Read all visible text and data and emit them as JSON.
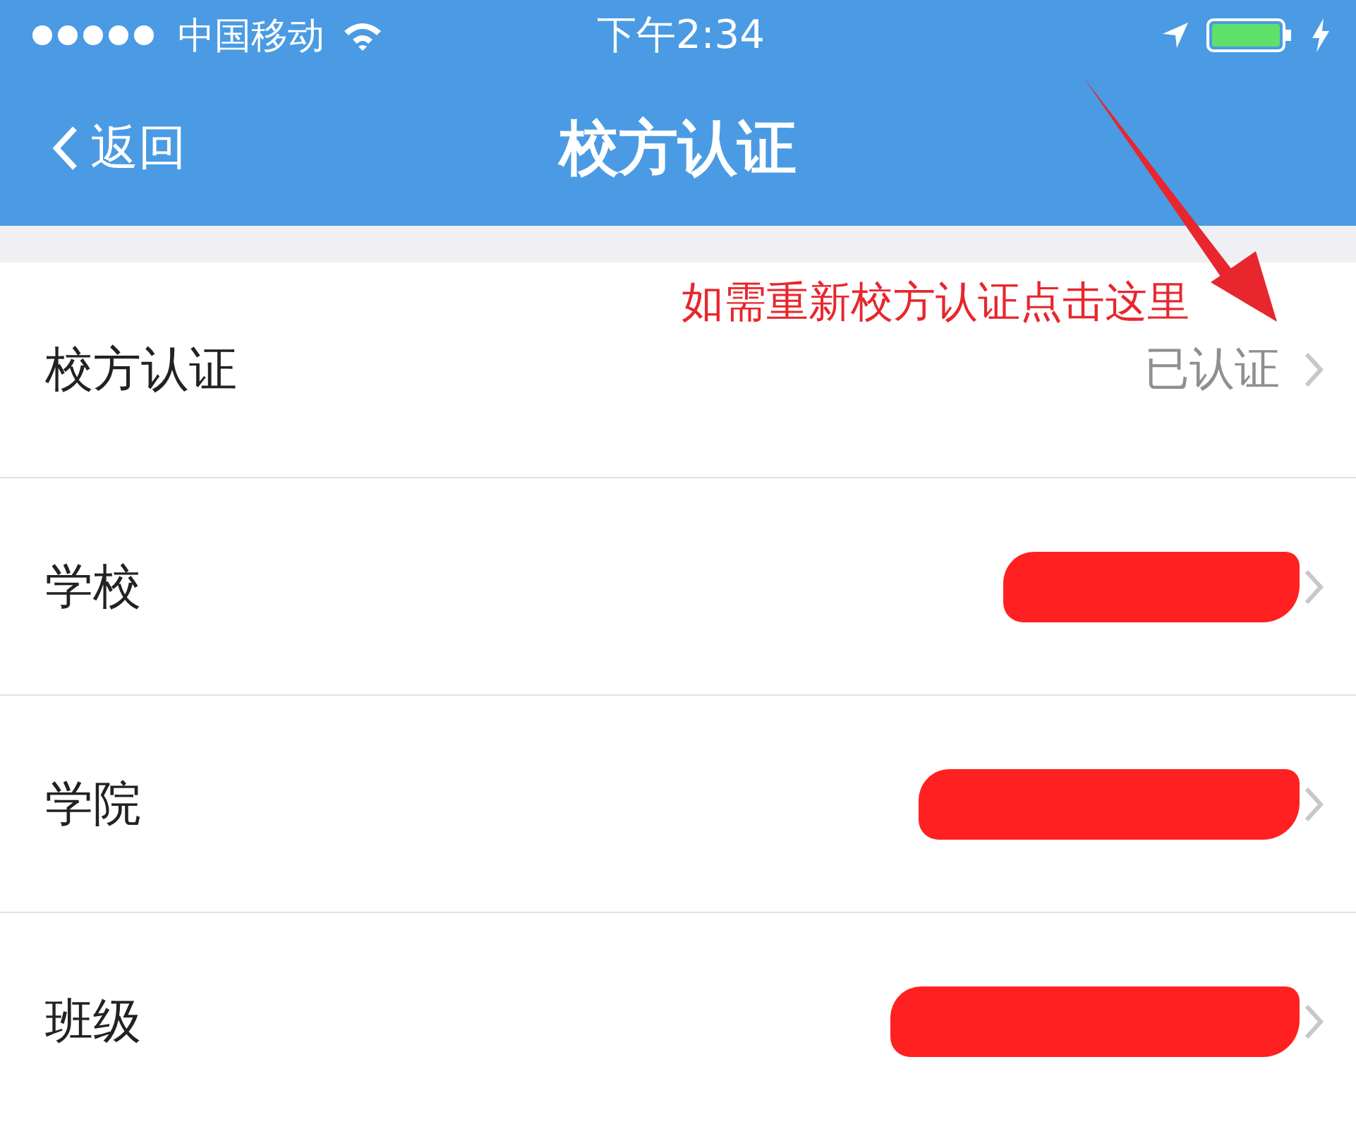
{
  "status_bar": {
    "carrier": "中国移动",
    "time": "下午2:34"
  },
  "nav": {
    "back": "返回",
    "title": "校方认证"
  },
  "annotation": {
    "text": "如需重新校方认证点击这里"
  },
  "rows": [
    {
      "label": "校方认证",
      "value": "已认证",
      "redacted": false
    },
    {
      "label": "学校",
      "redacted": true
    },
    {
      "label": "学院",
      "redacted": true
    },
    {
      "label": "班级",
      "redacted": true
    }
  ]
}
